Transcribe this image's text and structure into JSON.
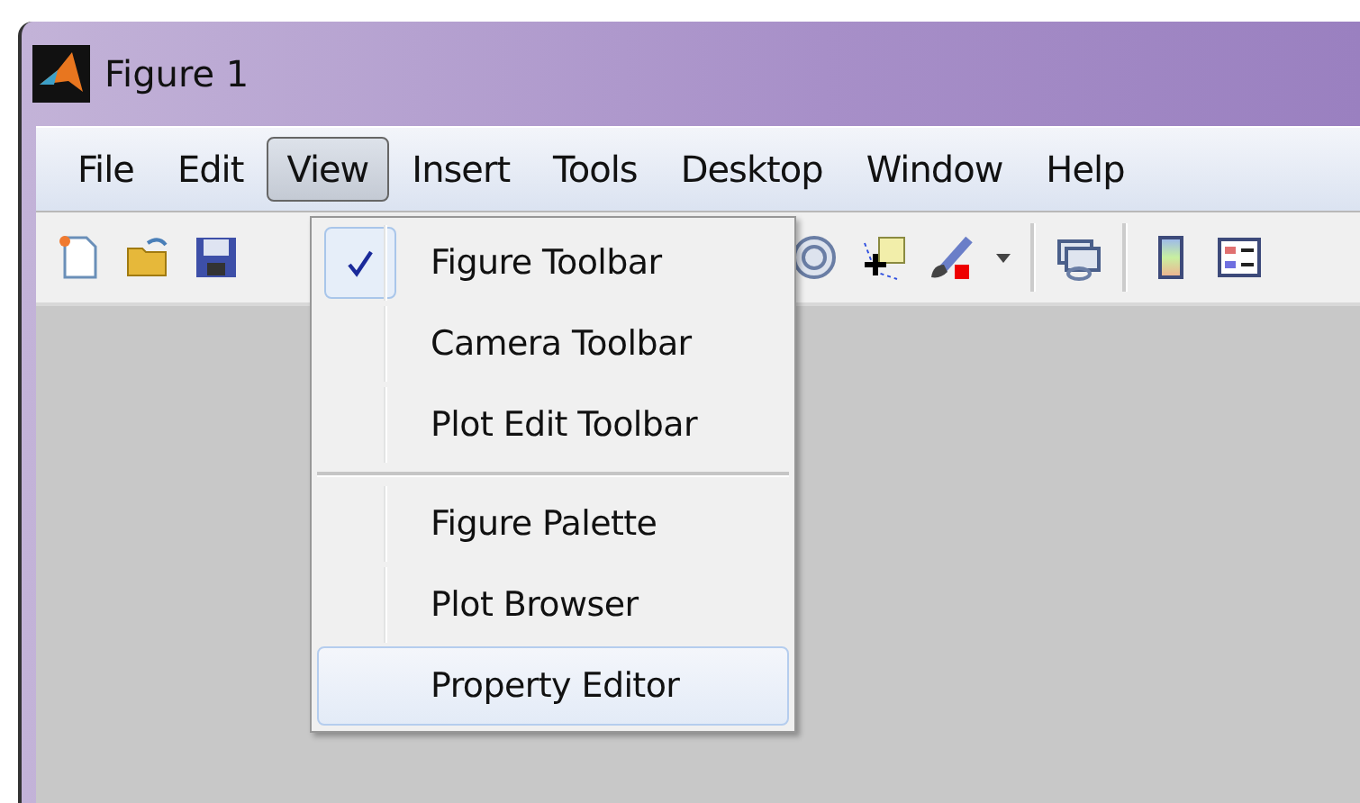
{
  "window": {
    "title": "Figure 1"
  },
  "menu_bar": [
    {
      "label": "File",
      "selected": false
    },
    {
      "label": "Edit",
      "selected": false
    },
    {
      "label": "View",
      "selected": true
    },
    {
      "label": "Insert",
      "selected": false
    },
    {
      "label": "Tools",
      "selected": false
    },
    {
      "label": "Desktop",
      "selected": false
    },
    {
      "label": "Window",
      "selected": false
    },
    {
      "label": "Help",
      "selected": false
    }
  ],
  "view_menu": {
    "groups": [
      [
        {
          "label": "Figure Toolbar",
          "checked": true,
          "selected": false
        },
        {
          "label": "Camera Toolbar",
          "checked": false,
          "selected": false
        },
        {
          "label": "Plot Edit Toolbar",
          "checked": false,
          "selected": false
        }
      ],
      [
        {
          "label": "Figure Palette",
          "checked": false,
          "selected": false
        },
        {
          "label": "Plot Browser",
          "checked": false,
          "selected": false
        },
        {
          "label": "Property Editor",
          "checked": false,
          "selected": true
        }
      ]
    ]
  }
}
